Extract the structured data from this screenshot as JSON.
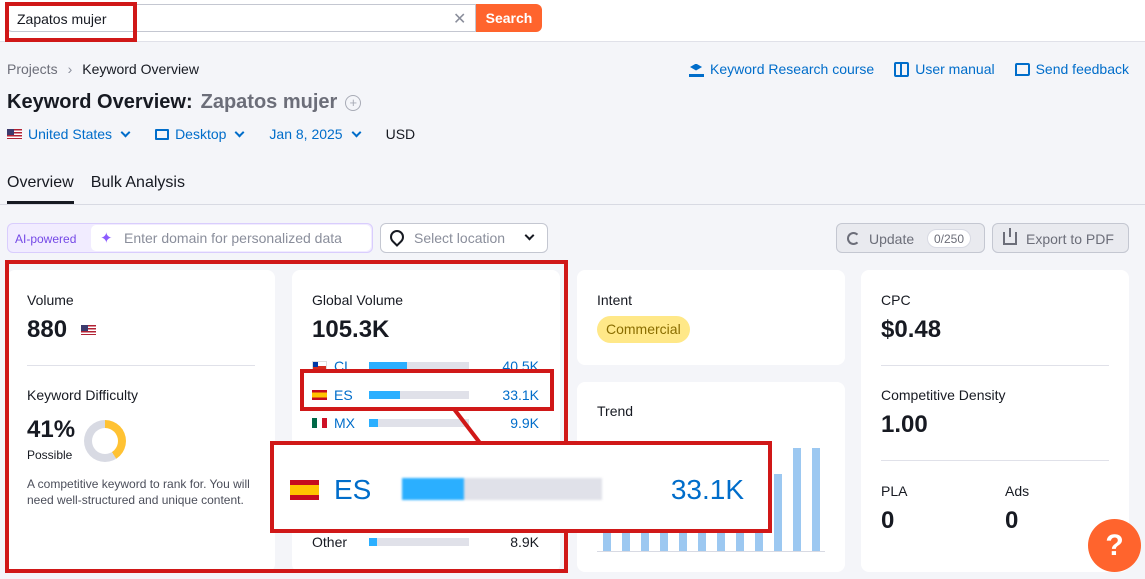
{
  "search": {
    "value": "Zapatos mujer",
    "button_label": "Search",
    "clear_icon": "close-icon"
  },
  "breadcrumb": {
    "items": [
      "Projects",
      "Keyword Overview"
    ]
  },
  "top_links": [
    {
      "label": "Keyword Research course",
      "icon": "graduation-cap-icon"
    },
    {
      "label": "User manual",
      "icon": "book-icon"
    },
    {
      "label": "Send feedback",
      "icon": "chat-icon"
    }
  ],
  "title": {
    "prefix": "Keyword Overview:",
    "keyword": "Zapatos mujer"
  },
  "filters": {
    "country": "United States",
    "device": "Desktop",
    "date": "Jan 8, 2025",
    "currency": "USD"
  },
  "tabs": [
    "Overview",
    "Bulk Analysis"
  ],
  "ai": {
    "badge": "AI-powered",
    "placeholder": "Enter domain for personalized data"
  },
  "location": {
    "placeholder": "Select location"
  },
  "actions": {
    "update_label": "Update",
    "update_count": "0/250",
    "export_label": "Export to PDF"
  },
  "volume": {
    "label": "Volume",
    "value": "880"
  },
  "kd": {
    "label": "Keyword Difficulty",
    "value": "41%",
    "level": "Possible",
    "percent": 41,
    "description": "A competitive keyword to rank for. You will need well-structured and unique content."
  },
  "global_volume": {
    "label": "Global Volume",
    "value": "105.3K",
    "rows": [
      {
        "code": "CL",
        "value": "40.5K",
        "fill": 0.38
      },
      {
        "code": "ES",
        "value": "33.1K",
        "fill": 0.31
      },
      {
        "code": "MX",
        "value": "9.9K",
        "fill": 0.09
      },
      {
        "code": "Other",
        "value": "8.9K",
        "fill": 0.08
      }
    ]
  },
  "intent": {
    "label": "Intent",
    "badge": "Commercial"
  },
  "trend": {
    "label": "Trend",
    "bars": [
      0.45,
      0.45,
      0.45,
      0.45,
      0.45,
      0.45,
      0.45,
      0.45,
      0.45,
      0.7,
      0.93,
      0.93
    ]
  },
  "cpc": {
    "label": "CPC",
    "value": "$0.48"
  },
  "competitive_density": {
    "label": "Competitive Density",
    "value": "1.00"
  },
  "pla": {
    "label": "PLA",
    "value": "0"
  },
  "ads": {
    "label": "Ads",
    "value": "0"
  },
  "zoom": {
    "code": "ES",
    "value": "33.1K",
    "fill": 0.31
  },
  "colors": {
    "accent": "#ff642d",
    "link": "#006dca",
    "highlight": "#d01818",
    "bar": "#2bafff",
    "intent_badge": "#ffe888"
  },
  "help": {
    "label": "?"
  }
}
